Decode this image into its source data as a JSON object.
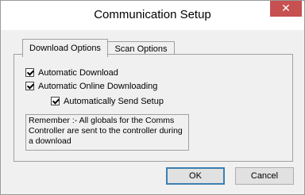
{
  "window": {
    "title": "Communication Setup",
    "close_glyph": "✕"
  },
  "tabs": [
    {
      "label": "Download Options",
      "active": true
    },
    {
      "label": "Scan Options",
      "active": false
    }
  ],
  "options": {
    "automatic_download": {
      "label": "Automatic Download",
      "checked": true
    },
    "automatic_online_downloading": {
      "label": "Automatic Online Downloading",
      "checked": true
    },
    "automatically_send_setup": {
      "label": "Automatically Send Setup",
      "checked": true
    }
  },
  "note": "Remember :- All globals for the Comms Controller are sent to the controller during a download",
  "buttons": {
    "ok": "OK",
    "cancel": "Cancel"
  },
  "colors": {
    "close_button": "#c75050",
    "default_button_border": "#3c7fb1"
  }
}
